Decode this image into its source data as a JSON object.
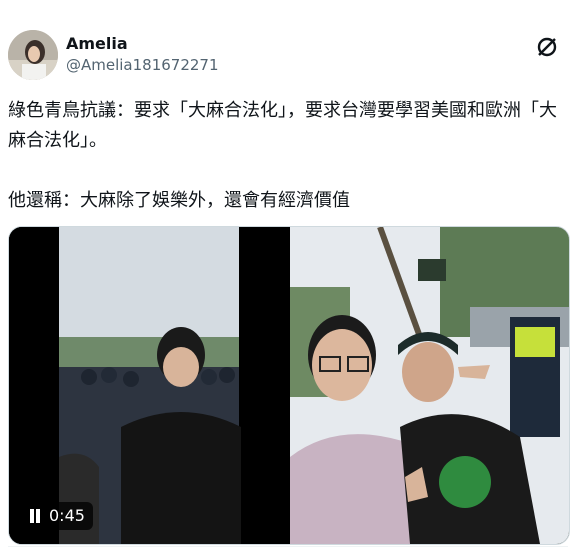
{
  "tweet": {
    "author_name": "Amelia",
    "author_handle": "@Amelia181672271",
    "text": "綠色青鳥抗議：要求「大麻合法化」，要求台灣要學習美國和歐洲「大麻合法化」。\n\n他還稱：大麻除了娛樂外，還會有經濟價值",
    "brand_icon": "x-logo-icon"
  },
  "media": {
    "video": {
      "duration": "0:45",
      "control_icon": "pause-icon"
    },
    "photo": {
      "description_icon": "selfie-photo"
    }
  }
}
